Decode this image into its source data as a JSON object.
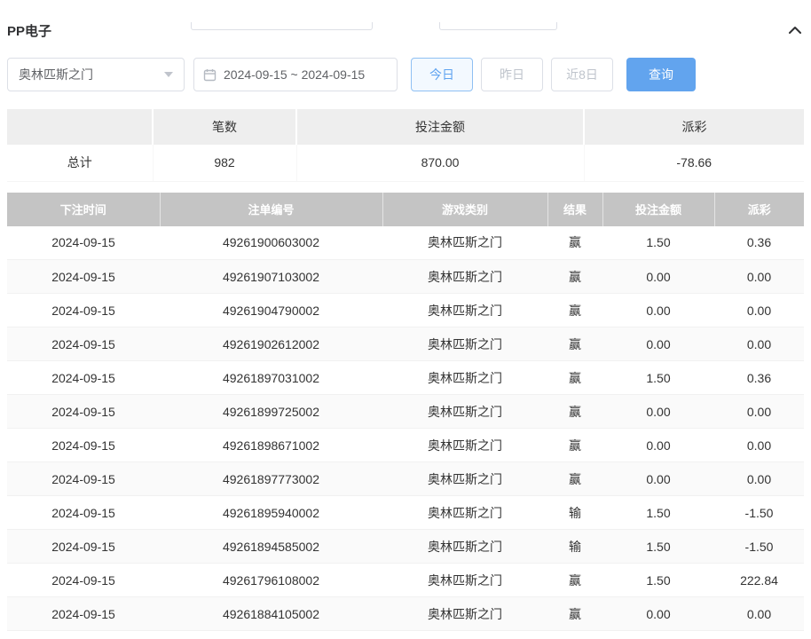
{
  "colors": {
    "accent_blue": "#62a4ee",
    "negative_red": "#f25c5c",
    "table_header_gray": "#c4c4c4",
    "summary_header_gray": "#eeeeee"
  },
  "panel": {
    "title": "PP电子"
  },
  "filters": {
    "game_select": {
      "value": "奥林匹斯之门"
    },
    "date_range": {
      "value": "2024-09-15 ~ 2024-09-15"
    },
    "quick_buttons": [
      {
        "id": "today",
        "label": "今日",
        "active": true
      },
      {
        "id": "yesterday",
        "label": "昨日",
        "active": false
      },
      {
        "id": "last-8-days",
        "label": "近8日",
        "active": false
      }
    ],
    "search_label": "查询"
  },
  "summary": {
    "headers": [
      "",
      "笔数",
      "投注金额",
      "派彩"
    ],
    "row": {
      "label": "总计",
      "count": "982",
      "bet_amount": "870.00",
      "payout": "-78.66"
    }
  },
  "table": {
    "headers": [
      "下注时间",
      "注单编号",
      "游戏类别",
      "结果",
      "投注金额",
      "派彩"
    ],
    "rows": [
      {
        "time": "2024-09-15",
        "order_no": "49261900603002",
        "game": "奥林匹斯之门",
        "result": "赢",
        "bet": "1.50",
        "payout": "0.36"
      },
      {
        "time": "2024-09-15",
        "order_no": "49261907103002",
        "game": "奥林匹斯之门",
        "result": "赢",
        "bet": "0.00",
        "payout": "0.00"
      },
      {
        "time": "2024-09-15",
        "order_no": "49261904790002",
        "game": "奥林匹斯之门",
        "result": "赢",
        "bet": "0.00",
        "payout": "0.00"
      },
      {
        "time": "2024-09-15",
        "order_no": "49261902612002",
        "game": "奥林匹斯之门",
        "result": "赢",
        "bet": "0.00",
        "payout": "0.00"
      },
      {
        "time": "2024-09-15",
        "order_no": "49261897031002",
        "game": "奥林匹斯之门",
        "result": "赢",
        "bet": "1.50",
        "payout": "0.36"
      },
      {
        "time": "2024-09-15",
        "order_no": "49261899725002",
        "game": "奥林匹斯之门",
        "result": "赢",
        "bet": "0.00",
        "payout": "0.00"
      },
      {
        "time": "2024-09-15",
        "order_no": "49261898671002",
        "game": "奥林匹斯之门",
        "result": "赢",
        "bet": "0.00",
        "payout": "0.00"
      },
      {
        "time": "2024-09-15",
        "order_no": "49261897773002",
        "game": "奥林匹斯之门",
        "result": "赢",
        "bet": "0.00",
        "payout": "0.00"
      },
      {
        "time": "2024-09-15",
        "order_no": "49261895940002",
        "game": "奥林匹斯之门",
        "result": "输",
        "bet": "1.50",
        "payout": "-1.50"
      },
      {
        "time": "2024-09-15",
        "order_no": "49261894585002",
        "game": "奥林匹斯之门",
        "result": "输",
        "bet": "1.50",
        "payout": "-1.50"
      },
      {
        "time": "2024-09-15",
        "order_no": "49261796108002",
        "game": "奥林匹斯之门",
        "result": "赢",
        "bet": "1.50",
        "payout": "222.84"
      },
      {
        "time": "2024-09-15",
        "order_no": "49261884105002",
        "game": "奥林匹斯之门",
        "result": "赢",
        "bet": "0.00",
        "payout": "0.00"
      }
    ]
  }
}
